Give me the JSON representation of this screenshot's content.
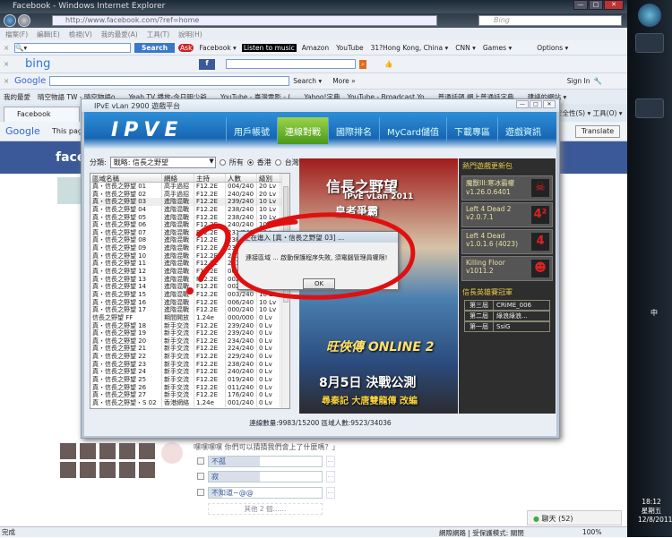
{
  "browser": {
    "title": "Facebook - Windows Internet Explorer",
    "url": "http://www.facebook.com/?ref=home",
    "search_placeholder": "Bing",
    "menu": [
      "檔案(F)",
      "編輯(E)",
      "檢視(V)",
      "我的最愛(A)",
      "工具(T)",
      "說明(H)"
    ],
    "toolbar1": {
      "search_label": "Search",
      "items": [
        "Facebook ▾",
        "Listen to music",
        "Amazon",
        "YouTube",
        "31?Hong Kong, China ▾",
        "CNN ▾",
        "Games ▾",
        "Options ▾"
      ]
    },
    "google": {
      "search": "Search ▾",
      "more": "More »",
      "signin": "Sign In"
    },
    "favorites": [
      "我的最愛",
      "晴空物語 TW - 晴空物語o...",
      "Yeah TV 播放-今日明少爺...",
      "YouTube - 臺灣電影 - (...",
      "Yahoo!字典",
      "YouTube - Broadcast Yo...",
      "普通話頓 網上普通話字典...",
      "建議的網站 ▾"
    ],
    "tab": "Facebook",
    "tools_right": "安全性(S) ▾   工具(O) ▾",
    "translate_prefix": "This pag",
    "translate_button": "Translate",
    "status_left": "完成",
    "status_zone": "網際網路 | 受保護模式: 關閉",
    "zoom": "100%"
  },
  "ipve": {
    "title": "IPvE vLan 2900 遊戲平台",
    "logo": "IPVE",
    "nav": [
      "用戶帳號",
      "連線對戰",
      "國際排名",
      "MyCard儲值",
      "下載專區",
      "遊戲資訊"
    ],
    "active_nav": 1,
    "category_label": "分類:",
    "category_value": "戰略: 信長之野望",
    "radios": [
      "所有",
      "香港",
      "台灣"
    ],
    "radio_selected": 1,
    "columns": [
      "區域名稱",
      "網絡",
      "主持",
      "人數",
      "級別"
    ],
    "rows": [
      [
        "真・信長之野望 01",
        "高手過招",
        "F12.2E",
        "004/240",
        "20 Lv"
      ],
      [
        "真・信長之野望 02",
        "高手過招",
        "F12.2E",
        "240/240",
        "20 Lv"
      ],
      [
        "真・信長之野望 03",
        "進階混戰",
        "F12.2E",
        "239/240",
        "10 Lv"
      ],
      [
        "真・信長之野望 04",
        "進階混戰",
        "F12.2E",
        "238/240",
        "10 Lv"
      ],
      [
        "真・信長之野望 05",
        "進階混戰",
        "F12.2E",
        "238/240",
        "10 Lv"
      ],
      [
        "真・信長之野望 06",
        "進階混戰",
        "F12.2E",
        "240/240",
        "10 Lv"
      ],
      [
        "真・信長之野望 07",
        "進階混戰",
        "F12.2E",
        "231/240",
        "10 Lv"
      ],
      [
        "真・信長之野望 08",
        "進階混戰",
        "F12.2E",
        "238/240",
        "10 Lv"
      ],
      [
        "真・信長之野望 09",
        "進階混戰",
        "F12.2E",
        "231/240",
        "10 Lv"
      ],
      [
        "真・信長之野望 10",
        "進階混戰",
        "F12.2E",
        "231/240",
        "10 Lv"
      ],
      [
        "真・信長之野望 11",
        "進階混戰",
        "F12.2E",
        "231/240",
        "10 Lv"
      ],
      [
        "真・信長之野望 12",
        "進階混戰",
        "F12.2E",
        "004/240",
        "10 Lv"
      ],
      [
        "真・信長之野望 13",
        "進階混戰",
        "F12.2E",
        "002/240",
        "10 Lv"
      ],
      [
        "真・信長之野望 14",
        "進階混戰",
        "F12.2E",
        "002/240",
        "10 Lv"
      ],
      [
        "真・信長之野望 15",
        "進階混戰",
        "F12.2E",
        "003/240",
        "10 Lv"
      ],
      [
        "真・信長之野望 16",
        "進階混戰",
        "F12.2E",
        "006/240",
        "10 Lv"
      ],
      [
        "真・信長之野望 17",
        "進階混戰",
        "F12.2E",
        "000/240",
        "10 Lv"
      ],
      [
        "信長之野望 FF",
        "期間開放",
        "1.24e",
        "000/000",
        "0 Lv"
      ],
      [
        "真・信長之野望 18",
        "新手交流",
        "F12.2E",
        "239/240",
        "0 Lv"
      ],
      [
        "真・信長之野望 19",
        "新手交流",
        "F12.2E",
        "239/240",
        "0 Lv"
      ],
      [
        "真・信長之野望 20",
        "新手交流",
        "F12.2E",
        "234/240",
        "0 Lv"
      ],
      [
        "真・信長之野望 21",
        "新手交流",
        "F12.2E",
        "224/240",
        "0 Lv"
      ],
      [
        "真・信長之野望 22",
        "新手交流",
        "F12.2E",
        "229/240",
        "0 Lv"
      ],
      [
        "真・信長之野望 23",
        "新手交流",
        "F12.2E",
        "238/240",
        "0 Lv"
      ],
      [
        "真・信長之野望 24",
        "新手交流",
        "F12.2E",
        "240/240",
        "0 Lv"
      ],
      [
        "真・信長之野望 25",
        "新手交流",
        "F12.2E",
        "019/240",
        "0 Lv"
      ],
      [
        "真・信長之野望 26",
        "新手交流",
        "F12.2E",
        "011/240",
        "0 Lv"
      ],
      [
        "真・信長之野望 27",
        "新手交流",
        "F12.2E",
        "176/240",
        "0 Lv"
      ],
      [
        "真・信長之野望・S 02",
        "香港網絡",
        "1.24e",
        "001/240",
        "0 Lv"
      ]
    ],
    "ad": {
      "title": "信長之野望",
      "sub": "IPvE vLan 2011",
      "sub2": "皇者爭霸",
      "promo": "8月5日 決戰公測",
      "promo2": "尋秦記 大唐雙龍傳 改編",
      "game": "旺俠傳 ONLINE 2"
    },
    "side_title": "熱門遊戲更新包",
    "games": [
      {
        "name": "魔獸III:寒冰霸權",
        "ver": "v1.26.0.6401",
        "icon": "☠"
      },
      {
        "name": "Left 4 Dead 2",
        "ver": "v2.0.7.1",
        "icon": "4²"
      },
      {
        "name": "Left 4 Dead",
        "ver": "v1.0.1.6 (4023)",
        "icon": "4"
      },
      {
        "name": "Killing Floor",
        "ver": "v1011.2",
        "icon": "☻"
      }
    ],
    "rank_title": "信長英雄賽冠軍",
    "ranks": [
      [
        "第三屆",
        "CRiME_006"
      ],
      [
        "第二屆",
        "綠浪綠浪..."
      ],
      [
        "第一屆",
        "SsiG"
      ]
    ],
    "footer": "連線數量:9983/15200    區域人數:9523/34036"
  },
  "dialog": {
    "title": "正在進入 [真・信長之野望 03] ...",
    "message": "連接區域 ... 啟動保護程序失敗, 須電腦管理員權限!",
    "ok": "OK"
  },
  "facebook": {
    "logo": "facebook",
    "post": "嘿嘿嘿嘿 你們可以猜猜我們會上了什麼嗎？」",
    "poll": [
      {
        "label": "不孤",
        "fraction": 0.45
      },
      {
        "label": "寂",
        "fraction": 0.45
      },
      {
        "label": "不知道~@@",
        "fraction": 0.12
      }
    ],
    "more": "其他 2 個……",
    "chat": "聊天 (52)"
  },
  "taskbar": {
    "time": "18:12",
    "weekday": "星期五",
    "date": "12/8/2011",
    "lang": "中"
  }
}
